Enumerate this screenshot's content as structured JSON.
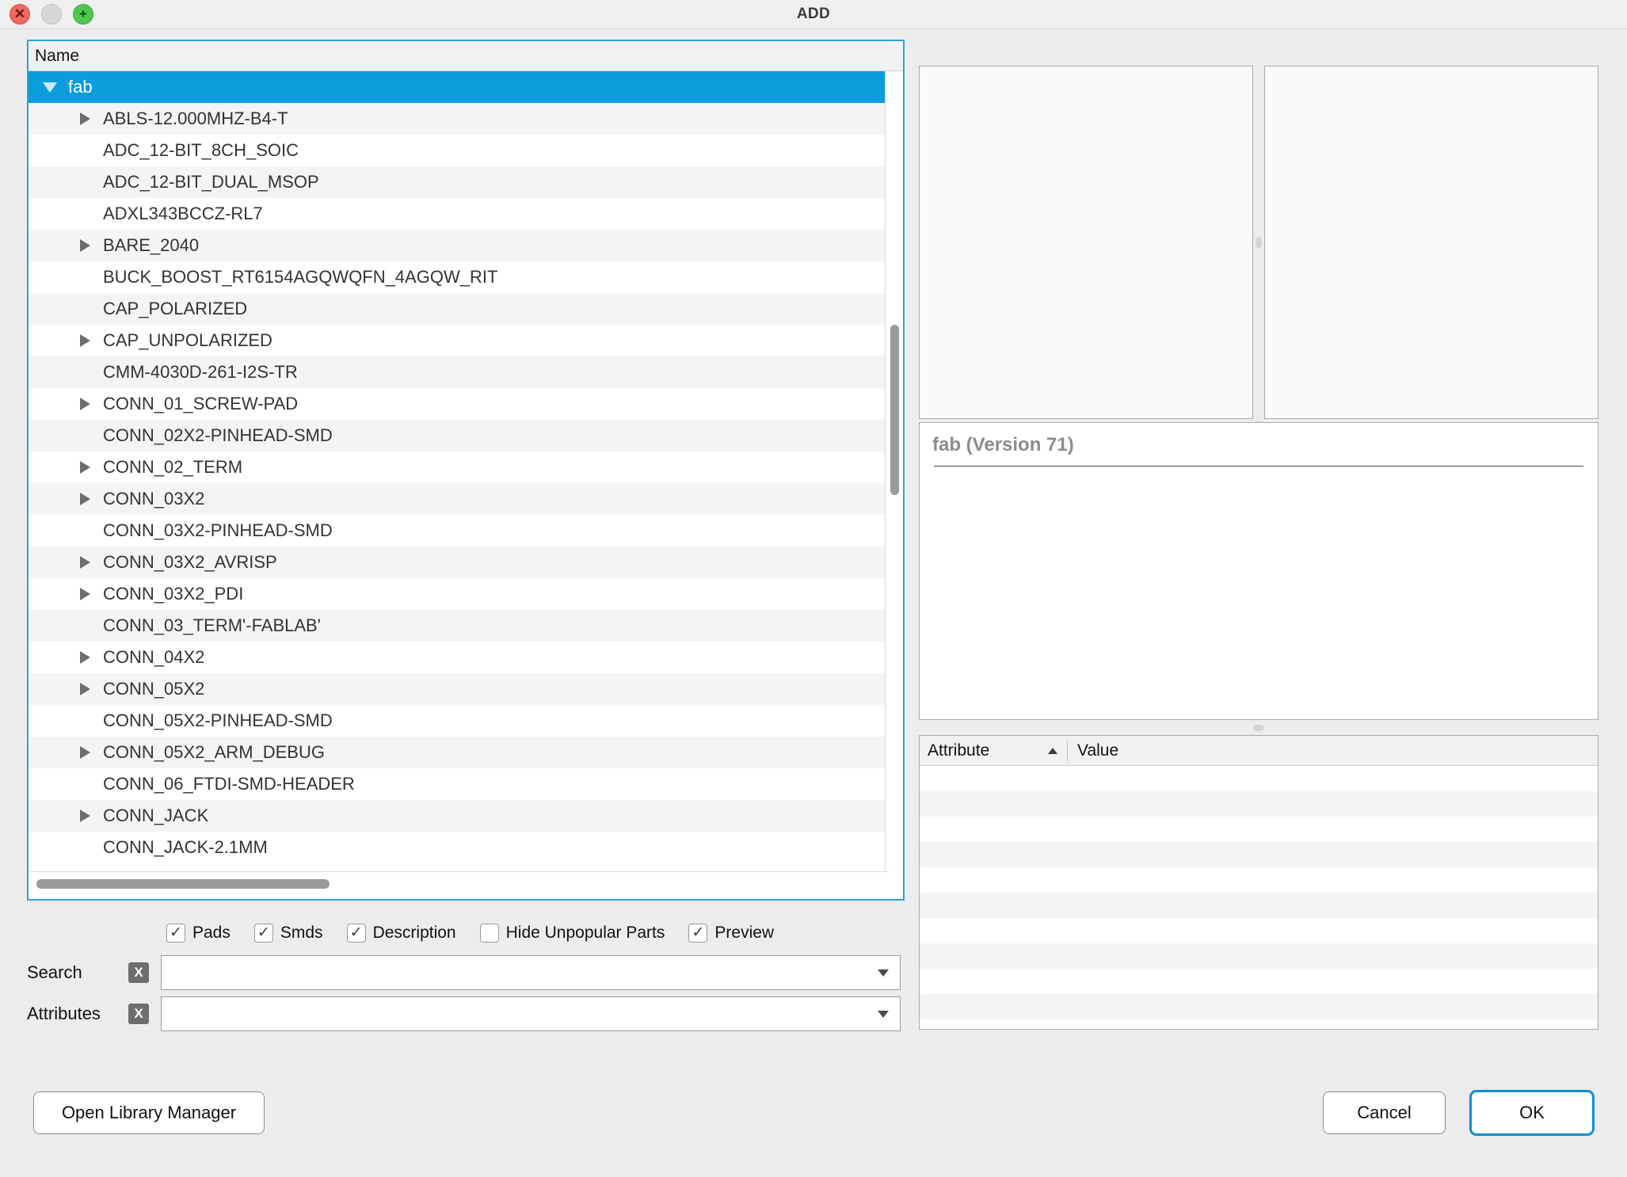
{
  "window": {
    "title": "ADD",
    "close_icon": "close-icon",
    "minimize_icon": "minimize-icon",
    "zoom_icon": "plus-icon",
    "close_glyph": "✕",
    "zoom_glyph": "+"
  },
  "tree": {
    "column_header": "Name",
    "selected_index": 0,
    "rows": [
      {
        "label": "fab",
        "depth": 0,
        "expandable": true,
        "expanded": true,
        "selected": true
      },
      {
        "label": "ABLS-12.000MHZ-B4-T",
        "depth": 1,
        "expandable": true,
        "expanded": false,
        "selected": false
      },
      {
        "label": "ADC_12-BIT_8CH_SOIC",
        "depth": 1,
        "expandable": false,
        "expanded": false,
        "selected": false
      },
      {
        "label": "ADC_12-BIT_DUAL_MSOP",
        "depth": 1,
        "expandable": false,
        "expanded": false,
        "selected": false
      },
      {
        "label": "ADXL343BCCZ-RL7",
        "depth": 1,
        "expandable": false,
        "expanded": false,
        "selected": false
      },
      {
        "label": "BARE_2040",
        "depth": 1,
        "expandable": true,
        "expanded": false,
        "selected": false
      },
      {
        "label": "BUCK_BOOST_RT6154AGQWQFN_4AGQW_RIT",
        "depth": 1,
        "expandable": false,
        "expanded": false,
        "selected": false
      },
      {
        "label": "CAP_POLARIZED",
        "depth": 1,
        "expandable": false,
        "expanded": false,
        "selected": false
      },
      {
        "label": "CAP_UNPOLARIZED",
        "depth": 1,
        "expandable": true,
        "expanded": false,
        "selected": false
      },
      {
        "label": "CMM-4030D-261-I2S-TR",
        "depth": 1,
        "expandable": false,
        "expanded": false,
        "selected": false
      },
      {
        "label": "CONN_01_SCREW-PAD",
        "depth": 1,
        "expandable": true,
        "expanded": false,
        "selected": false
      },
      {
        "label": "CONN_02X2-PINHEAD-SMD",
        "depth": 1,
        "expandable": false,
        "expanded": false,
        "selected": false
      },
      {
        "label": "CONN_02_TERM",
        "depth": 1,
        "expandable": true,
        "expanded": false,
        "selected": false
      },
      {
        "label": "CONN_03X2",
        "depth": 1,
        "expandable": true,
        "expanded": false,
        "selected": false
      },
      {
        "label": "CONN_03X2-PINHEAD-SMD",
        "depth": 1,
        "expandable": false,
        "expanded": false,
        "selected": false
      },
      {
        "label": "CONN_03X2_AVRISP",
        "depth": 1,
        "expandable": true,
        "expanded": false,
        "selected": false
      },
      {
        "label": "CONN_03X2_PDI",
        "depth": 1,
        "expandable": true,
        "expanded": false,
        "selected": false
      },
      {
        "label": "CONN_03_TERM'-FABLAB'",
        "depth": 1,
        "expandable": false,
        "expanded": false,
        "selected": false
      },
      {
        "label": "CONN_04X2",
        "depth": 1,
        "expandable": true,
        "expanded": false,
        "selected": false
      },
      {
        "label": "CONN_05X2",
        "depth": 1,
        "expandable": true,
        "expanded": false,
        "selected": false
      },
      {
        "label": "CONN_05X2-PINHEAD-SMD",
        "depth": 1,
        "expandable": false,
        "expanded": false,
        "selected": false
      },
      {
        "label": "CONN_05X2_ARM_DEBUG",
        "depth": 1,
        "expandable": true,
        "expanded": false,
        "selected": false
      },
      {
        "label": "CONN_06_FTDI-SMD-HEADER",
        "depth": 1,
        "expandable": false,
        "expanded": false,
        "selected": false
      },
      {
        "label": "CONN_JACK",
        "depth": 1,
        "expandable": true,
        "expanded": false,
        "selected": false
      },
      {
        "label": "CONN_JACK-2.1MM",
        "depth": 1,
        "expandable": false,
        "expanded": false,
        "selected": false
      }
    ]
  },
  "filters": {
    "checkboxes": [
      {
        "label": "Pads",
        "checked": true
      },
      {
        "label": "Smds",
        "checked": true
      },
      {
        "label": "Description",
        "checked": true
      },
      {
        "label": "Hide Unpopular Parts",
        "checked": false
      },
      {
        "label": "Preview",
        "checked": true
      }
    ],
    "check_glyph": "✓"
  },
  "search": {
    "label": "Search",
    "clear_glyph": "X",
    "value": "",
    "placeholder": ""
  },
  "attributes_filter": {
    "label": "Attributes",
    "clear_glyph": "X",
    "value": "",
    "placeholder": ""
  },
  "preview": {
    "symbol_pane": "",
    "package_pane": ""
  },
  "description": {
    "title": "fab (Version 71)",
    "body": ""
  },
  "attribute_table": {
    "columns": [
      "Attribute",
      "Value"
    ],
    "sort_column": "Attribute",
    "sort_direction": "asc",
    "rows": []
  },
  "footer": {
    "open_library_manager": "Open Library Manager",
    "cancel": "Cancel",
    "ok": "OK"
  },
  "colors": {
    "selection_blue": "#0a9ddb",
    "focus_blue": "#2aa3d8",
    "ok_border_blue": "#0d8ecf",
    "window_bg": "#ececec",
    "row_alt": "#f4f4f4"
  }
}
